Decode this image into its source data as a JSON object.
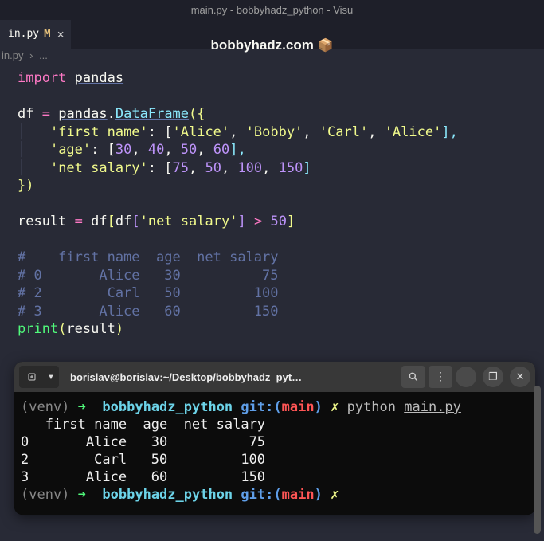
{
  "window": {
    "title": "main.py - bobbyhadz_python - Visu"
  },
  "tab": {
    "filename": "in.py",
    "modified_indicator": "M",
    "close_icon": "×"
  },
  "banner": {
    "text": "bobbyhadz.com ",
    "emoji": "📦"
  },
  "breadcrumb": {
    "file": "in.py",
    "sep": "›",
    "more": "..."
  },
  "code": {
    "l1_import": "import",
    "l1_pandas": "pandas",
    "l3_df": "df",
    "l3_eq": "=",
    "l3_pan": "pandas",
    "l3_dot": ".",
    "l3_df2": "DataFrame",
    "l3_open": "({",
    "l4_key": "'first name'",
    "l4_colon": ": [",
    "l4_v1": "'Alice'",
    "l4_v2": "'Bobby'",
    "l4_v3": "'Carl'",
    "l4_v4": "'Alice'",
    "l4_close": "],",
    "l5_key": "'age'",
    "l5_colon": ": [",
    "l5_v1": "30",
    "l5_v2": "40",
    "l5_v3": "50",
    "l5_v4": "60",
    "l5_close": "],",
    "l6_key": "'net salary'",
    "l6_colon": ": [",
    "l6_v1": "75",
    "l6_v2": "50",
    "l6_v3": "100",
    "l6_v4": "150",
    "l6_close": "]",
    "l7_close": "})",
    "l9_res": "result",
    "l9_eq": "=",
    "l9_dfv": "df",
    "l9_b1": "[",
    "l9_dfv2": "df",
    "l9_b2": "[",
    "l9_key": "'net salary'",
    "l9_b3": "]",
    "l9_gt": ">",
    "l9_num": "50",
    "l9_b4": "]",
    "c1": "#    first name  age  net salary",
    "c2": "# 0       Alice   30          75",
    "c3": "# 2        Carl   50         100",
    "c4": "# 3       Alice   60         150",
    "l15_print": "print",
    "l15_open": "(",
    "l15_arg": "result",
    "l15_close": ")"
  },
  "terminal": {
    "header_title": "borislav@borislav:~/Desktop/bobbyhadz_pyt…",
    "prompt_venv": "(venv)",
    "prompt_arrow": "➜",
    "prompt_dir": "bobbyhadz_python",
    "prompt_git": "git:(",
    "prompt_branch": "main",
    "prompt_git_close": ")",
    "prompt_dirty": "✗",
    "cmd_python": "python",
    "cmd_file": "main.py",
    "out_header": "   first name  age  net salary",
    "out_r1": "0       Alice   30          75",
    "out_r2": "2        Carl   50         100",
    "out_r3": "3       Alice   60         150"
  }
}
